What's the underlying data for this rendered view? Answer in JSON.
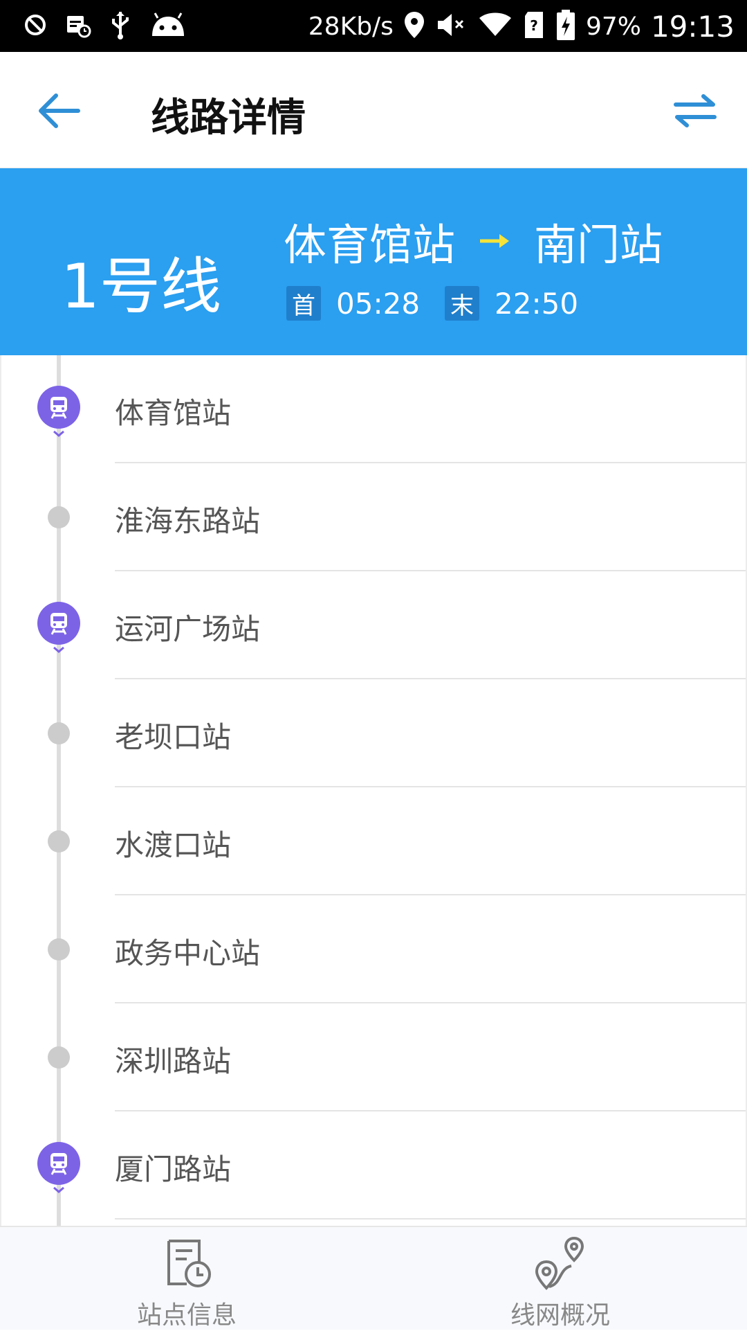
{
  "status_bar": {
    "network_speed": "28Kb/s",
    "battery": "97%",
    "time": "19:13",
    "icons": [
      "blocked-icon",
      "calendar-clock-icon",
      "usb-icon",
      "android-icon",
      "location-icon",
      "mute-icon",
      "wifi-icon",
      "sim-unknown-icon",
      "battery-charging-icon"
    ]
  },
  "app_bar": {
    "title": "线路详情",
    "back_icon": "back-arrow-icon",
    "swap_icon": "swap-direction-icon"
  },
  "line_banner": {
    "line_name": "1号线",
    "from_station": "体育馆站",
    "to_station": "南门站",
    "first_label": "首",
    "first_time": "05:28",
    "last_label": "末",
    "last_time": "22:50"
  },
  "stations": [
    {
      "name": "体育馆站",
      "marker": "metro"
    },
    {
      "name": "淮海东路站",
      "marker": "dot"
    },
    {
      "name": "运河广场站",
      "marker": "metro"
    },
    {
      "name": "老坝口站",
      "marker": "dot"
    },
    {
      "name": "水渡口站",
      "marker": "dot"
    },
    {
      "name": "政务中心站",
      "marker": "dot"
    },
    {
      "name": "深圳路站",
      "marker": "dot"
    },
    {
      "name": "厦门路站",
      "marker": "metro"
    }
  ],
  "bottom_nav": {
    "items": [
      {
        "label": "站点信息",
        "icon": "station-info-icon"
      },
      {
        "label": "线网概况",
        "icon": "network-map-icon"
      }
    ]
  },
  "colors": {
    "banner_blue": "#2b9ff0",
    "metro_purple": "#7c63e6",
    "arrow_yellow": "#f5e33a",
    "icon_blue": "#2f8fd6"
  }
}
